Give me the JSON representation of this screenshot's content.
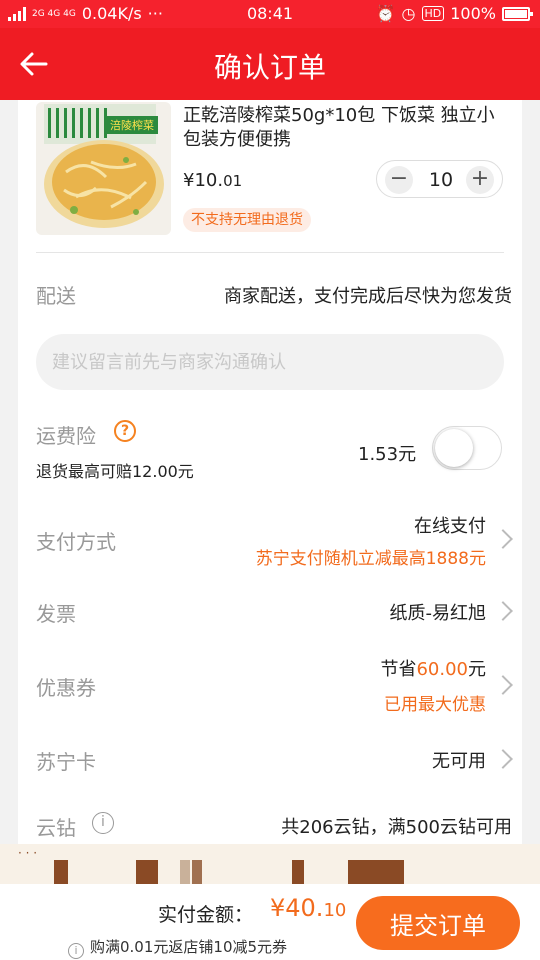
{
  "status_bar": {
    "network": "2G 4G 4G",
    "speed": "0.04K/s",
    "dots": "···",
    "time": "08:41",
    "battery": "100%",
    "icons": [
      "alarm-icon",
      "clock-icon",
      "hd-icon",
      "battery-icon"
    ]
  },
  "header": {
    "title": "确认订单",
    "back_icon": "back-arrow-icon"
  },
  "product": {
    "title": "正乾涪陵榨菜50g*10包 下饭菜 独立小包装方便便携",
    "image_label": "涪陵榨菜",
    "price_main": "¥10.",
    "price_cents": "01",
    "tag": "不支持无理由退货",
    "quantity": "10",
    "minus": "−",
    "plus": "+"
  },
  "delivery": {
    "label": "配送",
    "value": "商家配送，支付完成后尽快为您发货"
  },
  "message": {
    "placeholder": "建议留言前先与商家沟通确认"
  },
  "insurance": {
    "label": "运费险",
    "help": "?",
    "sub": "退货最高可赔12.00元",
    "price": "1.53元",
    "enabled": false
  },
  "payment": {
    "label": "支付方式",
    "value": "在线支付",
    "promo": "苏宁支付随机立减最高1888元"
  },
  "invoice": {
    "label": "发票",
    "value": "纸质-易红旭"
  },
  "coupon": {
    "label": "优惠券",
    "save_prefix": "节省",
    "save_amount": "60.00",
    "save_suffix": "元",
    "note": "已用最大优惠"
  },
  "suning_card": {
    "label": "苏宁卡",
    "value": "无可用"
  },
  "cloud_diamond": {
    "label": "云钻",
    "info": "i",
    "value": "共206云钻，满500云钻可用"
  },
  "footer": {
    "total_label": "实付金额：",
    "total_main": "¥40.",
    "total_cents": "10",
    "promo": "购满0.01元返店铺10减5元券",
    "submit": "提交订单"
  },
  "colors": {
    "header_red": "#ef1c23",
    "accent_orange": "#f26b1d",
    "submit_orange": "#f76c1e"
  }
}
